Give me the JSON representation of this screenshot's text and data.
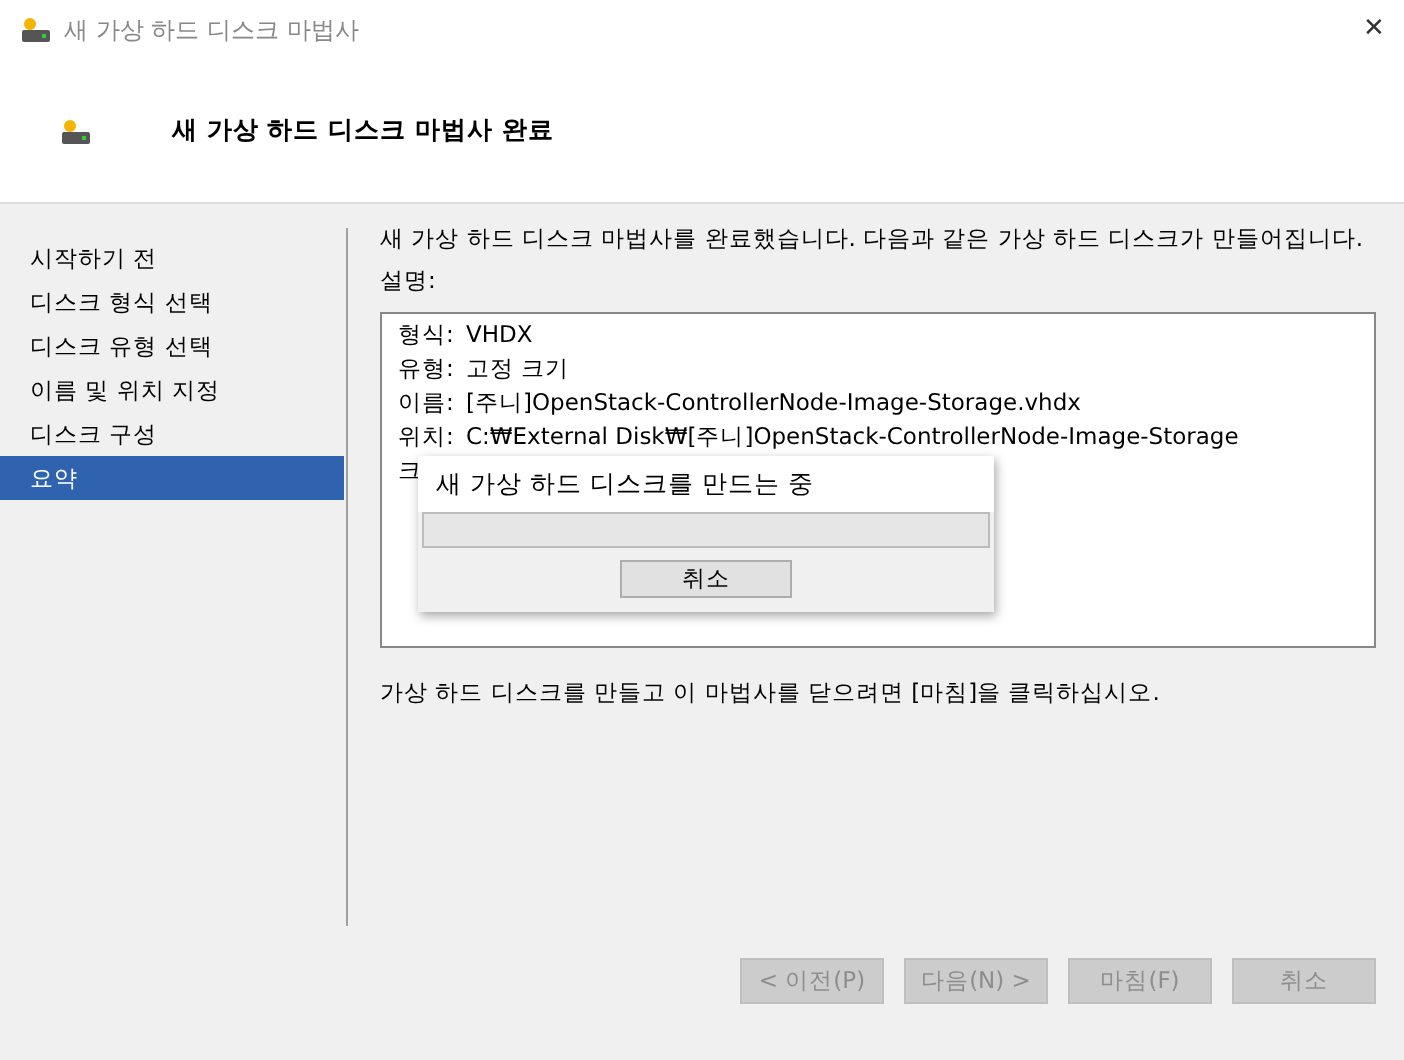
{
  "window": {
    "title": "새 가상 하드 디스크 마법사",
    "close": "✕"
  },
  "header": {
    "title": "새 가상 하드 디스크 마법사 완료"
  },
  "steps": [
    {
      "label": "시작하기 전",
      "selected": false
    },
    {
      "label": "디스크 형식 선택",
      "selected": false
    },
    {
      "label": "디스크 유형 선택",
      "selected": false
    },
    {
      "label": "이름 및 위치 지정",
      "selected": false
    },
    {
      "label": "디스크 구성",
      "selected": false
    },
    {
      "label": "요약",
      "selected": true
    }
  ],
  "intro": "새 가상 하드 디스크 마법사를 완료했습니다. 다음과 같은 가상 하드 디스크가 만들어집니다.",
  "description_label": "설명:",
  "summary": [
    {
      "label": "형식:",
      "value": "VHDX"
    },
    {
      "label": "유형:",
      "value": "고정 크기"
    },
    {
      "label": "이름:",
      "value": "[주니]OpenStack-ControllerNode-Image-Storage.vhdx"
    },
    {
      "label": "위치:",
      "value": "C:₩External Disk₩[주니]OpenStack-ControllerNode-Image-Storage"
    },
    {
      "label": "크"
    }
  ],
  "progress_dialog": {
    "title": "새 가상 하드 디스크를 만드는 중",
    "level": 0,
    "cancel": "취소"
  },
  "footer_note": "가상 하드 디스크를 만들고 이 마법사를 닫으려면 [마침]을 클릭하십시오.",
  "buttons": [
    {
      "label": "< 이전(P)",
      "disabled": true
    },
    {
      "label": "다음(N) >",
      "disabled": true
    },
    {
      "label": "마침(F)",
      "disabled": true
    },
    {
      "label": "취소",
      "disabled": true
    }
  ]
}
